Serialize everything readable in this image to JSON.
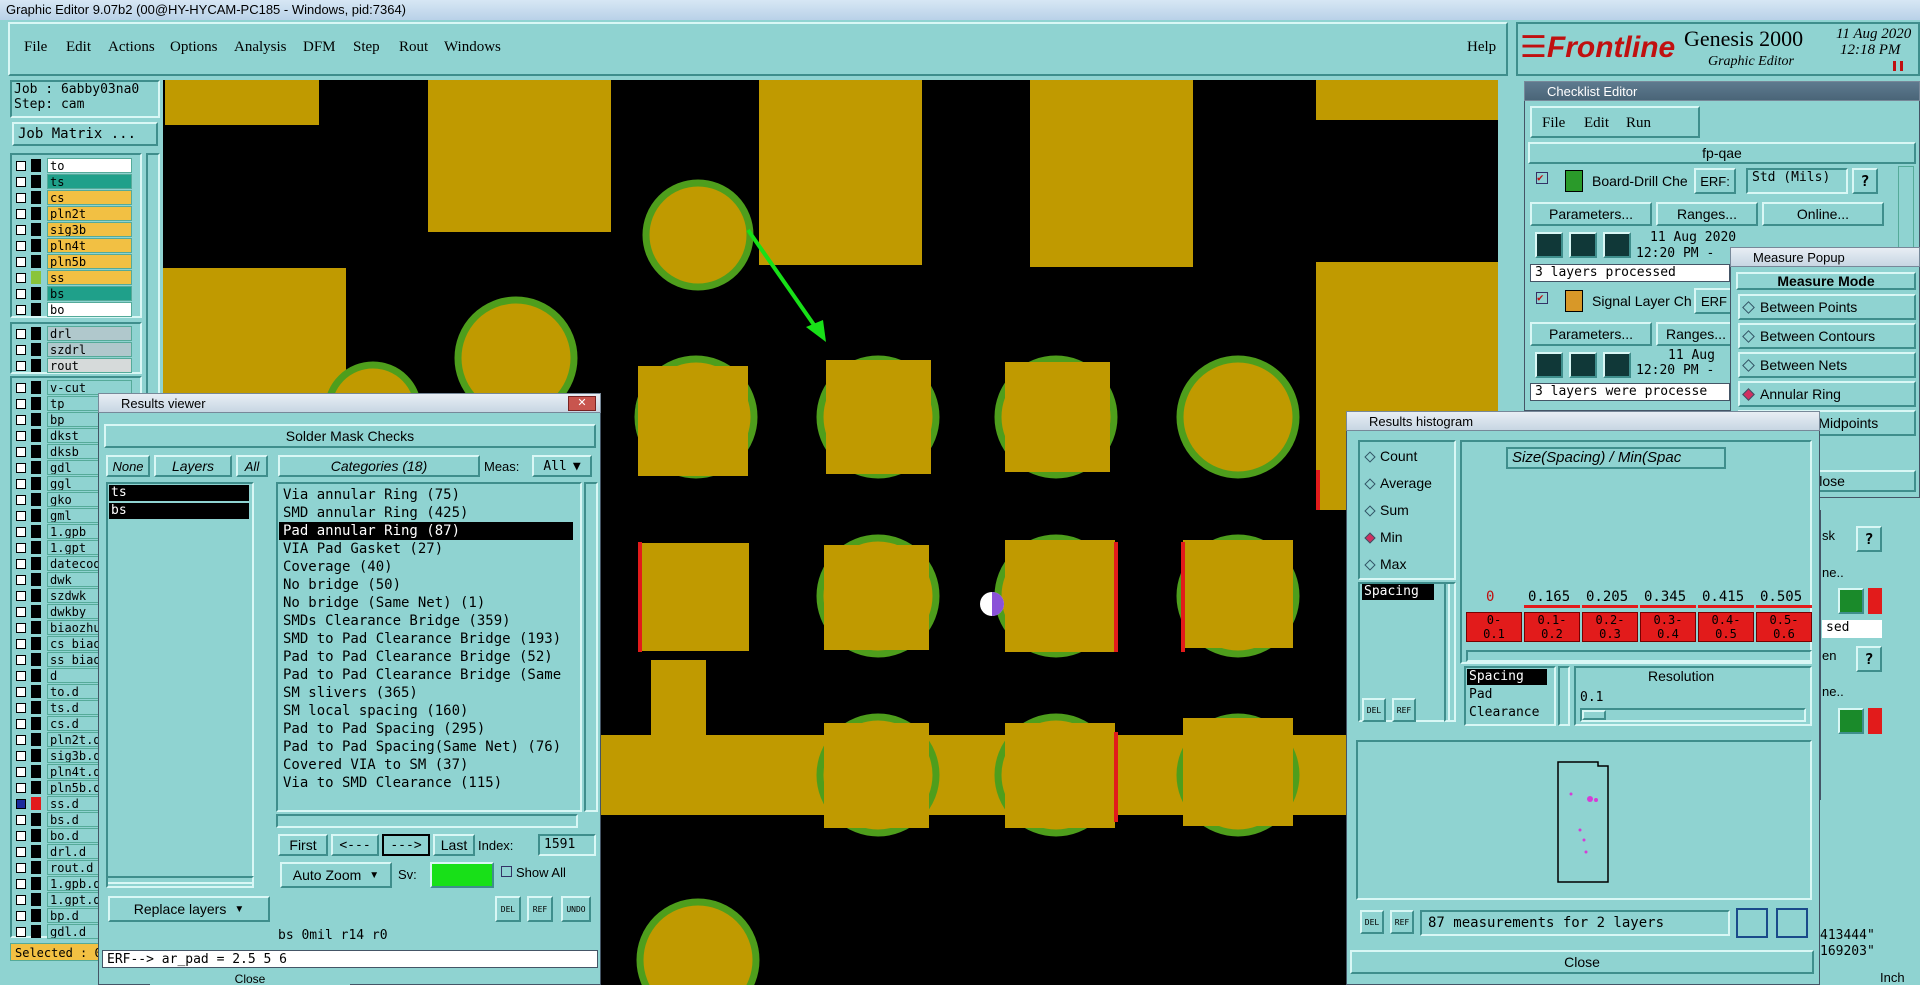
{
  "window": {
    "title": "Graphic Editor 9.07b2 (00@HY-HYCAM-PC185 - Windows, pid:7364)"
  },
  "menu": [
    "File",
    "Edit",
    "Actions",
    "Options",
    "Analysis",
    "DFM",
    "Step",
    "Rout",
    "Windows"
  ],
  "help": "Help",
  "brand": {
    "logo": "Frontline",
    "product": "Genesis 2000",
    "sub": "Graphic Editor",
    "date": "11 Aug 2020",
    "time": "12:18 PM"
  },
  "job": {
    "job": "Job : 6abby03na0",
    "step": "Step: cam",
    "matrix_btn": "Job Matrix ..."
  },
  "layers_top": [
    {
      "name": "to",
      "color": "#ffffff",
      "sw": "#000000"
    },
    {
      "name": "ts",
      "color": "#1fa08a",
      "sw": "#000000"
    },
    {
      "name": "cs",
      "color": "#f2c043",
      "sw": "#000000"
    },
    {
      "name": "pln2t",
      "color": "#f2c043",
      "sw": "#000000"
    },
    {
      "name": "sig3b",
      "color": "#f2c043",
      "sw": "#000000"
    },
    {
      "name": "pln4t",
      "color": "#f2c043",
      "sw": "#000000"
    },
    {
      "name": "pln5b",
      "color": "#f2c043",
      "sw": "#000000"
    },
    {
      "name": "ss",
      "color": "#f2c043",
      "sw": "#8ac43a"
    },
    {
      "name": "bs",
      "color": "#1fa08a",
      "sw": "#000000"
    },
    {
      "name": "bo",
      "color": "#ffffff",
      "sw": "#000000"
    }
  ],
  "layers_drill": [
    {
      "name": "drl",
      "color": "#b0c8cc",
      "sw": "#000000"
    },
    {
      "name": "szdrl",
      "color": "#b0c8cc",
      "sw": "#000000"
    },
    {
      "name": "rout",
      "color": "#d6dada",
      "sw": "#000000"
    }
  ],
  "layers_misc": [
    "v-cut",
    "tp",
    "bp",
    "dkst",
    "dksb",
    "gdl",
    "ggl",
    "gko",
    "gml",
    "1.gpb",
    "1.gpt",
    "datecod",
    "dwk",
    "szdwk",
    "dwkby",
    "biaozhu",
    "cs_biao",
    "ss_biao",
    "d",
    "to.d",
    "ts.d",
    "cs.d",
    "pln2t.d",
    "sig3b.d",
    "pln4t.d",
    "pln5b.d",
    "ss.d",
    "bs.d",
    "bo.d",
    "drl.d",
    "rout.d",
    "1.gpb.d",
    "1.gpt.d",
    "bp.d",
    "gdl.d"
  ],
  "selected_label": "Selected : 0",
  "results_viewer": {
    "title": "Results viewer",
    "header": "Solder Mask Checks",
    "none": "None",
    "layers": "Layers",
    "all": "All",
    "categories_label": "Categories (18)",
    "meas_label": "Meas:",
    "meas_value": "All",
    "layer_items": [
      "ts",
      "bs"
    ],
    "categories": [
      "Via annular Ring (75)",
      "SMD annular Ring (425)",
      "Pad annular Ring (87)",
      "VIA Pad Gasket (27)",
      "Coverage (40)",
      "No bridge (50)",
      "No bridge (Same Net) (1)",
      "SMDs Clearance Bridge (359)",
      "SMD to Pad Clearance Bridge (193)",
      "Pad to Pad Clearance Bridge (52)",
      "Pad to Pad Clearance Bridge (Same",
      "SM slivers (365)",
      "SM local spacing (160)",
      "Pad to Pad Spacing (295)",
      "Pad to Pad Spacing(Same Net) (76)",
      "Covered VIA to SM (37)",
      "Via to SMD Clearance (115)"
    ],
    "selected_category": 2,
    "first": "First",
    "prev": "<---",
    "next": "--->",
    "last": "Last",
    "index_label": "Index:",
    "index_value": "1591",
    "zoom": "Auto Zoom",
    "sv": "Sv:",
    "show_all": "Show All",
    "replace": "Replace layers",
    "status": "bs 0mil  r14  r0",
    "erf": "ERF--> ar_pad = 2.5 5 6",
    "close": "Close"
  },
  "checklist": {
    "title": "Checklist Editor",
    "menu": [
      "File",
      "Edit",
      "Run"
    ],
    "name": "fp-qae",
    "action1": "Board-Drill Che",
    "erf": "ERF:",
    "erf_value": "Std (Mils)",
    "params": "Parameters...",
    "ranges": "Ranges...",
    "online": "Online...",
    "date1": "11 Aug 2020",
    "time1": "12:20 PM -",
    "processed1": "3 layers processed",
    "action2": "Signal Layer Ch",
    "erf2": "ERF",
    "date2": "11 Aug",
    "time2": "12:20 PM -",
    "processed2": "3 layers were processe"
  },
  "measure": {
    "title": "Measure Popup",
    "mode": "Measure Mode",
    "options": [
      "Between Points",
      "Between Contours",
      "Between Nets",
      "Annular Ring",
      "Between Midpoints"
    ],
    "selected": 3,
    "close": "Close"
  },
  "histogram": {
    "title": "Results histogram",
    "modes": [
      "Count",
      "Average",
      "Sum",
      "Min",
      "Max"
    ],
    "selected_mode": 3,
    "heading": "Size(Spacing) / Min(Spac",
    "list": [
      "Spacing"
    ],
    "col_labels": [
      "0",
      "0.165",
      "0.205",
      "0.345",
      "0.415",
      "0.505"
    ],
    "bins": [
      "0-\n0.1",
      "0.1-\n0.2",
      "0.2-\n0.3",
      "0.3-\n0.4",
      "0.4-\n0.5",
      "0.5-\n0.6"
    ],
    "measure_list": [
      "Spacing",
      "Pad",
      "Clearance"
    ],
    "resolution_label": "Resolution",
    "resolution_value": "0.1",
    "summary": "87 measurements for 2 layers",
    "close": "Close"
  },
  "right_side": {
    "k1": "sk",
    "k2": "ne..",
    "k3": "sed",
    "k4": "en",
    "k5": "ne..",
    "coord1": "413444\"",
    "coord2": "169203\"",
    "inch": "Inch"
  },
  "colors": {
    "copper": "#c09a00",
    "mask_ring": "#4e9e1c",
    "panel": "#8fd3d1",
    "highlight": "#e21b1b",
    "arrow": "#18e018"
  }
}
